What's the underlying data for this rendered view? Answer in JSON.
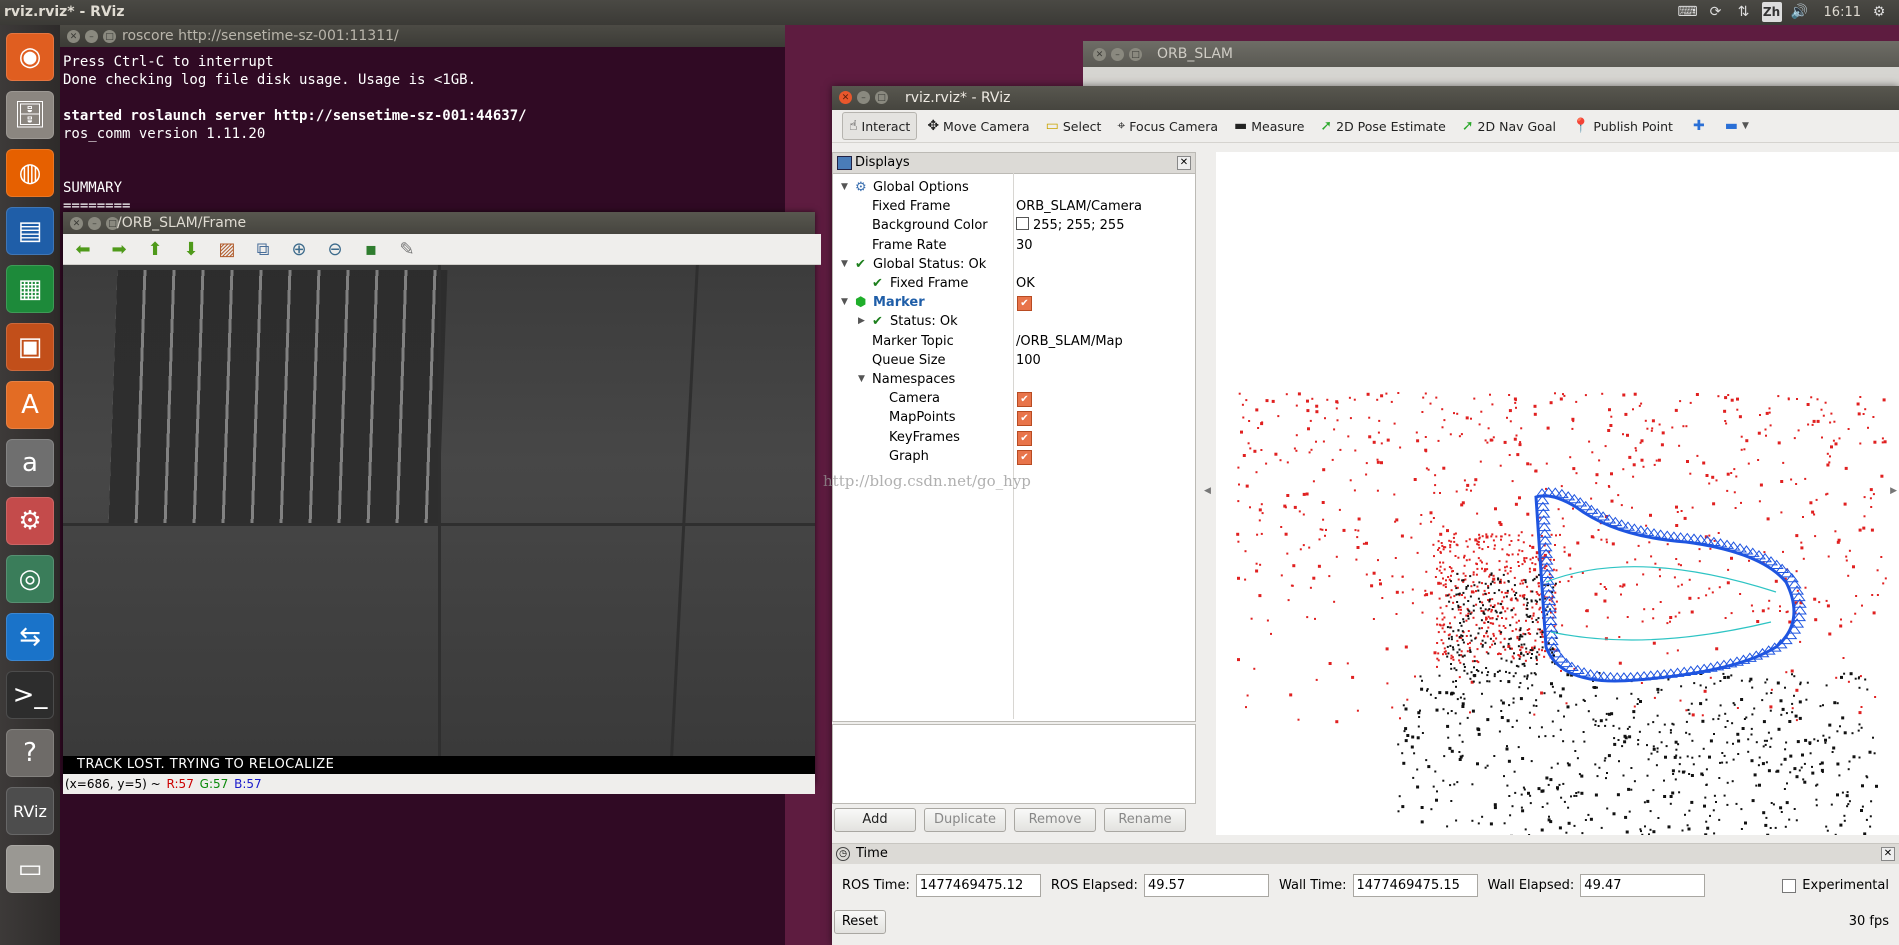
{
  "top_panel": {
    "title": "rviz.rviz* - RViz",
    "input_method": "Zh",
    "clock": "16:11"
  },
  "launcher": {
    "items": [
      {
        "name": "ubuntu-dash-icon",
        "glyph": "◉",
        "color": "#e05e20"
      },
      {
        "name": "files-icon",
        "glyph": "🗄",
        "color": "#8b8680"
      },
      {
        "name": "firefox-icon",
        "glyph": "◍",
        "color": "#e66000"
      },
      {
        "name": "writer-icon",
        "glyph": "▤",
        "color": "#1f5ea8"
      },
      {
        "name": "calc-icon",
        "glyph": "▦",
        "color": "#1d8a3a"
      },
      {
        "name": "impress-icon",
        "glyph": "▣",
        "color": "#c24f1a"
      },
      {
        "name": "software-center-icon",
        "glyph": "A",
        "color": "#e36c24"
      },
      {
        "name": "amazon-icon",
        "glyph": "a",
        "color": "#6f6f6f"
      },
      {
        "name": "settings-icon",
        "glyph": "⚙",
        "color": "#c44b4b"
      },
      {
        "name": "eye-app-icon",
        "glyph": "◎",
        "color": "#3a7d5a"
      },
      {
        "name": "teamviewer-icon",
        "glyph": "⇆",
        "color": "#1a73c9"
      },
      {
        "name": "terminal-icon",
        "glyph": ">_",
        "color": "#2d2d2d"
      },
      {
        "name": "help-icon",
        "glyph": "?",
        "color": "#6e6b68"
      },
      {
        "name": "rviz-icon",
        "glyph": "RViz",
        "color": "#4d4d4d"
      },
      {
        "name": "disk-icon",
        "glyph": "▭",
        "color": "#9a9893"
      }
    ]
  },
  "terminal": {
    "title": "roscore http://sensetime-sz-001:11311/",
    "lines": [
      {
        "text": "Press Ctrl-C to interrupt",
        "bold": false
      },
      {
        "text": "Done checking log file disk usage. Usage is <1GB.",
        "bold": false
      },
      {
        "text": "",
        "bold": false
      },
      {
        "text": "started roslaunch server http://sensetime-sz-001:44637/",
        "bold": true
      },
      {
        "text": "ros_comm version 1.11.20",
        "bold": false
      },
      {
        "text": "",
        "bold": false
      },
      {
        "text": "",
        "bold": false
      },
      {
        "text": "SUMMARY",
        "bold": false
      },
      {
        "text": "========",
        "bold": false
      }
    ]
  },
  "image_view": {
    "title": "/ORB_SLAM/Frame",
    "toolbar": [
      {
        "name": "back-arrow-icon",
        "glyph": "⬅",
        "color": "#4f9a1a"
      },
      {
        "name": "forward-arrow-icon",
        "glyph": "➡",
        "color": "#4f9a1a"
      },
      {
        "name": "up-arrow-icon",
        "glyph": "⬆",
        "color": "#4f9a1a"
      },
      {
        "name": "down-arrow-icon",
        "glyph": "⬇",
        "color": "#4f9a1a"
      },
      {
        "name": "image-icon",
        "glyph": "▨",
        "color": "#b05a2a"
      },
      {
        "name": "fit-window-icon",
        "glyph": "⧉",
        "color": "#4a6f9a"
      },
      {
        "name": "zoom-in-icon",
        "glyph": "⊕",
        "color": "#3d6b8c"
      },
      {
        "name": "zoom-out-icon",
        "glyph": "⊖",
        "color": "#3d6b8c"
      },
      {
        "name": "save-icon",
        "glyph": "▪",
        "color": "#2f7d2f"
      },
      {
        "name": "brush-icon",
        "glyph": "✎",
        "color": "#777777"
      }
    ],
    "status_message": "TRACK LOST. TRYING TO RELOCALIZE",
    "pixel_info": {
      "coords": "(x=686, y=5) ~",
      "r": "R:57",
      "g": "G:57",
      "b": "B:57",
      "r_color": "#cc0000",
      "g_color": "#0a8a0a",
      "b_color": "#1a1acc"
    }
  },
  "orb_slam_window": {
    "title": "ORB_SLAM"
  },
  "rviz": {
    "title": "rviz.rviz* - RViz",
    "tools": [
      {
        "name": "interact-tool",
        "icon": "interact-icon",
        "glyph": "☝",
        "label": "Interact",
        "active": true
      },
      {
        "name": "move-camera-tool",
        "icon": "move-camera-icon",
        "glyph": "✥",
        "label": "Move Camera",
        "active": false
      },
      {
        "name": "select-tool",
        "icon": "select-icon",
        "glyph": "▭",
        "label": "Select",
        "active": false
      },
      {
        "name": "focus-camera-tool",
        "icon": "focus-camera-icon",
        "glyph": "⌖",
        "label": "Focus Camera",
        "active": false
      },
      {
        "name": "measure-tool",
        "icon": "measure-icon",
        "glyph": "▬",
        "label": "Measure",
        "active": false
      },
      {
        "name": "2d-pose-estimate-tool",
        "icon": "pose-estimate-icon",
        "glyph": "➚",
        "label": "2D Pose Estimate",
        "active": false
      },
      {
        "name": "2d-nav-goal-tool",
        "icon": "nav-goal-icon",
        "glyph": "➚",
        "label": "2D Nav Goal",
        "active": false
      },
      {
        "name": "publish-point-tool",
        "icon": "map-pin-icon",
        "glyph": "📍",
        "label": "Publish Point",
        "active": false
      }
    ],
    "displays": {
      "title": "Displays",
      "rows": [
        {
          "id": "global-options",
          "label": "Global Options",
          "value": "",
          "arrow": "▼",
          "check": false,
          "checkbox": false,
          "icon": "gear"
        },
        {
          "id": "fixed-frame",
          "label": "Fixed Frame",
          "value": "ORB_SLAM/Camera"
        },
        {
          "id": "background-color",
          "label": "Background Color",
          "value": "255; 255; 255",
          "swatch": true
        },
        {
          "id": "frame-rate",
          "label": "Frame Rate",
          "value": "30"
        },
        {
          "id": "global-status",
          "label": "Global Status: Ok",
          "value": "",
          "arrow": "▼",
          "check": true
        },
        {
          "id": "global-status-fixed-frame",
          "label": "Fixed Frame",
          "value": "OK",
          "check": true
        },
        {
          "id": "marker",
          "label": "Marker",
          "value": "",
          "arrow": "▼",
          "checkbox": true,
          "icon": "cube"
        },
        {
          "id": "marker-status",
          "label": "Status: Ok",
          "value": "",
          "arrow": "▶",
          "check": true
        },
        {
          "id": "marker-topic",
          "label": "Marker Topic",
          "value": "/ORB_SLAM/Map"
        },
        {
          "id": "queue-size",
          "label": "Queue Size",
          "value": "100"
        },
        {
          "id": "namespaces",
          "label": "Namespaces",
          "value": "",
          "arrow": "▼"
        },
        {
          "id": "ns-camera",
          "label": "Camera",
          "value": "",
          "checkbox": true
        },
        {
          "id": "ns-mappoints",
          "label": "MapPoints",
          "value": "",
          "checkbox": true
        },
        {
          "id": "ns-keyframes",
          "label": "KeyFrames",
          "value": "",
          "checkbox": true
        },
        {
          "id": "ns-graph",
          "label": "Graph",
          "value": "",
          "checkbox": true
        }
      ]
    },
    "panel_buttons": {
      "add": "Add",
      "duplicate": "Duplicate",
      "remove": "Remove",
      "rename": "Rename"
    },
    "time": {
      "title": "Time",
      "ros_time_label": "ROS Time:",
      "ros_time": "1477469475.12",
      "ros_elapsed_label": "ROS Elapsed:",
      "ros_elapsed": "49.57",
      "wall_time_label": "Wall Time:",
      "wall_time": "1477469475.15",
      "wall_elapsed_label": "Wall Elapsed:",
      "wall_elapsed": "49.47",
      "experimental_label": "Experimental",
      "reset_label": "Reset",
      "fps": "30 fps"
    },
    "colors": {
      "map_points": "#e02020",
      "reference_points": "#111111",
      "keyframes": "#1f55e0",
      "graph": "#2ec4c4"
    }
  },
  "watermark": "http://blog.csdn.net/go_hyp"
}
